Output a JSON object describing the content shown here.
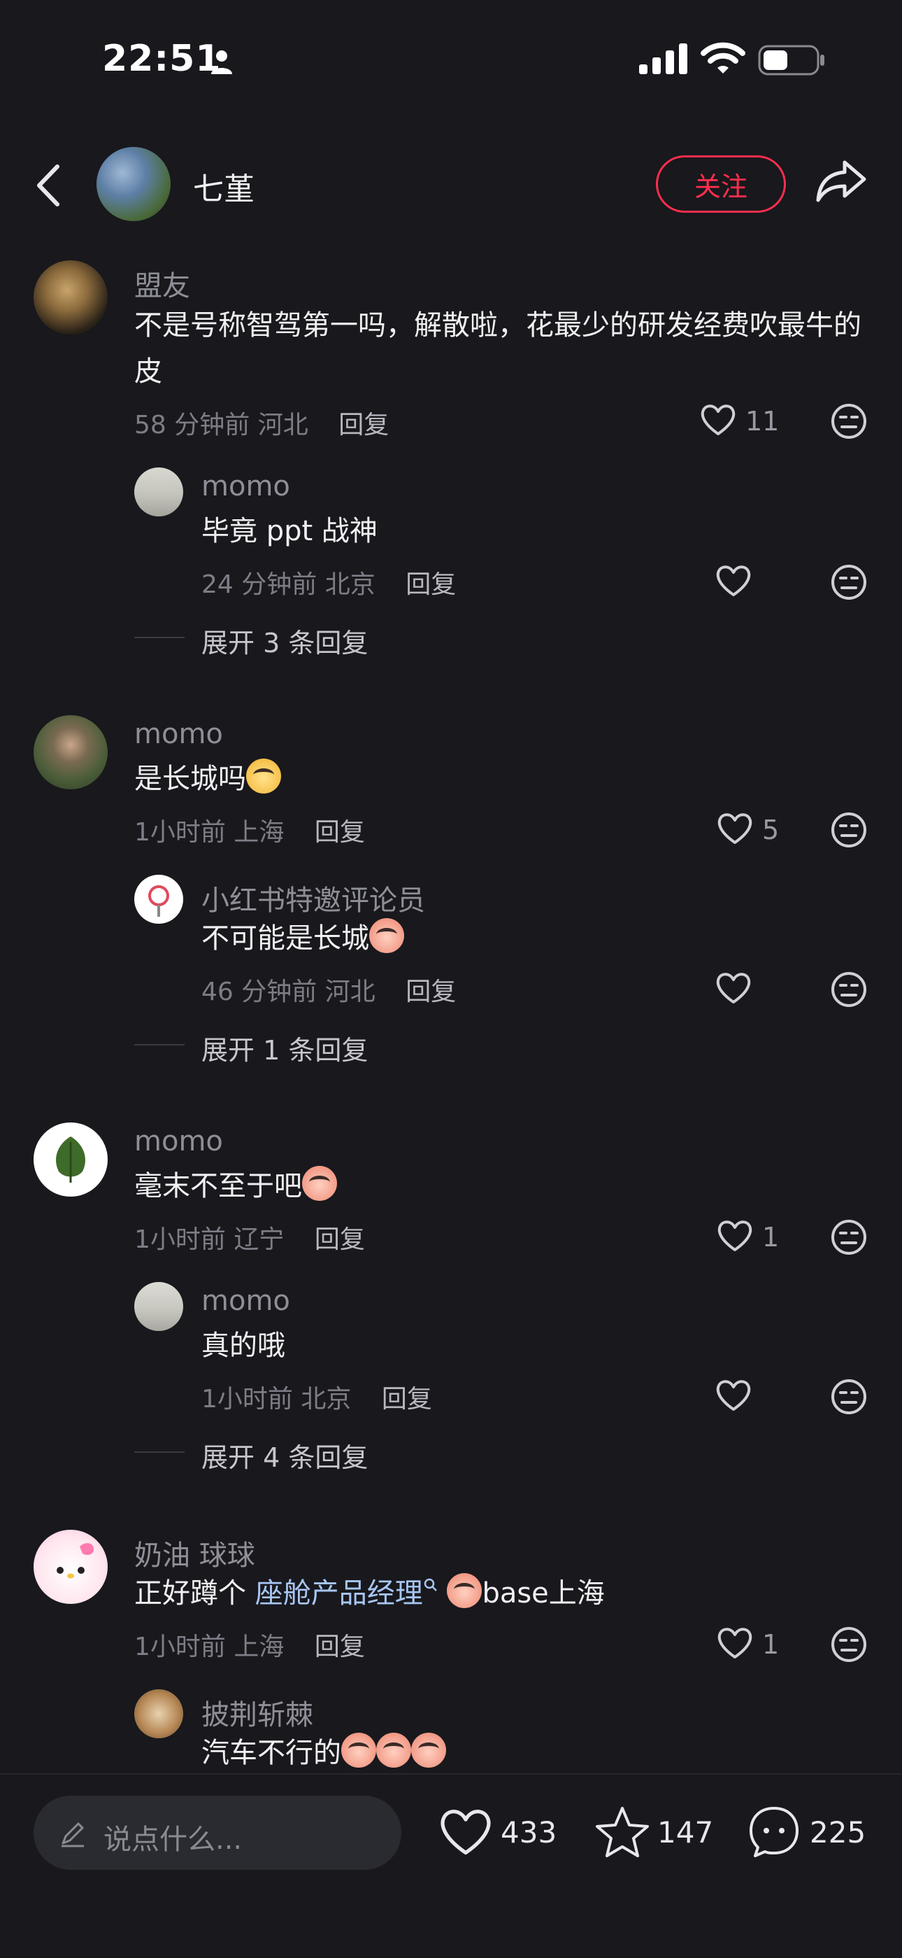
{
  "status_bar": {
    "time": "22:51"
  },
  "header": {
    "author": "七堇",
    "follow_label": "关注"
  },
  "comments": [
    {
      "user": "盟友",
      "text": "不是号称智驾第一吗，解散啦，花最少的研发经费吹最牛的皮",
      "time": "58 分钟前",
      "location": "河北",
      "reply": "回复",
      "likes": "11",
      "sub": {
        "user": "momo",
        "text": "毕竟 ppt 战神",
        "time": "24 分钟前",
        "location": "北京",
        "reply": "回复",
        "likes": ""
      },
      "expand": "展开 3 条回复"
    },
    {
      "user": "momo",
      "text": "是长城吗",
      "time": "1小时前",
      "location": "上海",
      "reply": "回复",
      "likes": "5",
      "sub": {
        "user": "小红书特邀评论员",
        "text": "不可能是长城",
        "time": "46 分钟前",
        "location": "河北",
        "reply": "回复",
        "likes": ""
      },
      "expand": "展开 1 条回复"
    },
    {
      "user": "momo",
      "text": "毫末不至于吧",
      "time": "1小时前",
      "location": "辽宁",
      "reply": "回复",
      "likes": "1",
      "sub": {
        "user": "momo",
        "text": "真的哦",
        "time": "1小时前",
        "location": "北京",
        "reply": "回复",
        "likes": ""
      },
      "expand": "展开 4 条回复"
    },
    {
      "user": "奶油 球球",
      "text_prefix": "正好蹲个 ",
      "text_link": "座舱产品经理",
      "text_suffix": "base上海",
      "time": "1小时前",
      "location": "上海",
      "reply": "回复",
      "likes": "1",
      "sub": {
        "user": "披荆斩棘",
        "text": "汽车不行的"
      }
    }
  ],
  "bottom_bar": {
    "placeholder": "说点什么...",
    "likes": "433",
    "favorites": "147",
    "comments": "225"
  },
  "icons": [
    "chevron-left-icon",
    "share-icon",
    "heart-icon",
    "emotion-icon",
    "pencil-icon",
    "star-icon",
    "comment-icon"
  ],
  "colors": {
    "background": "#18181d",
    "accent": "#ff2e4d",
    "link": "#a8c6f2"
  }
}
